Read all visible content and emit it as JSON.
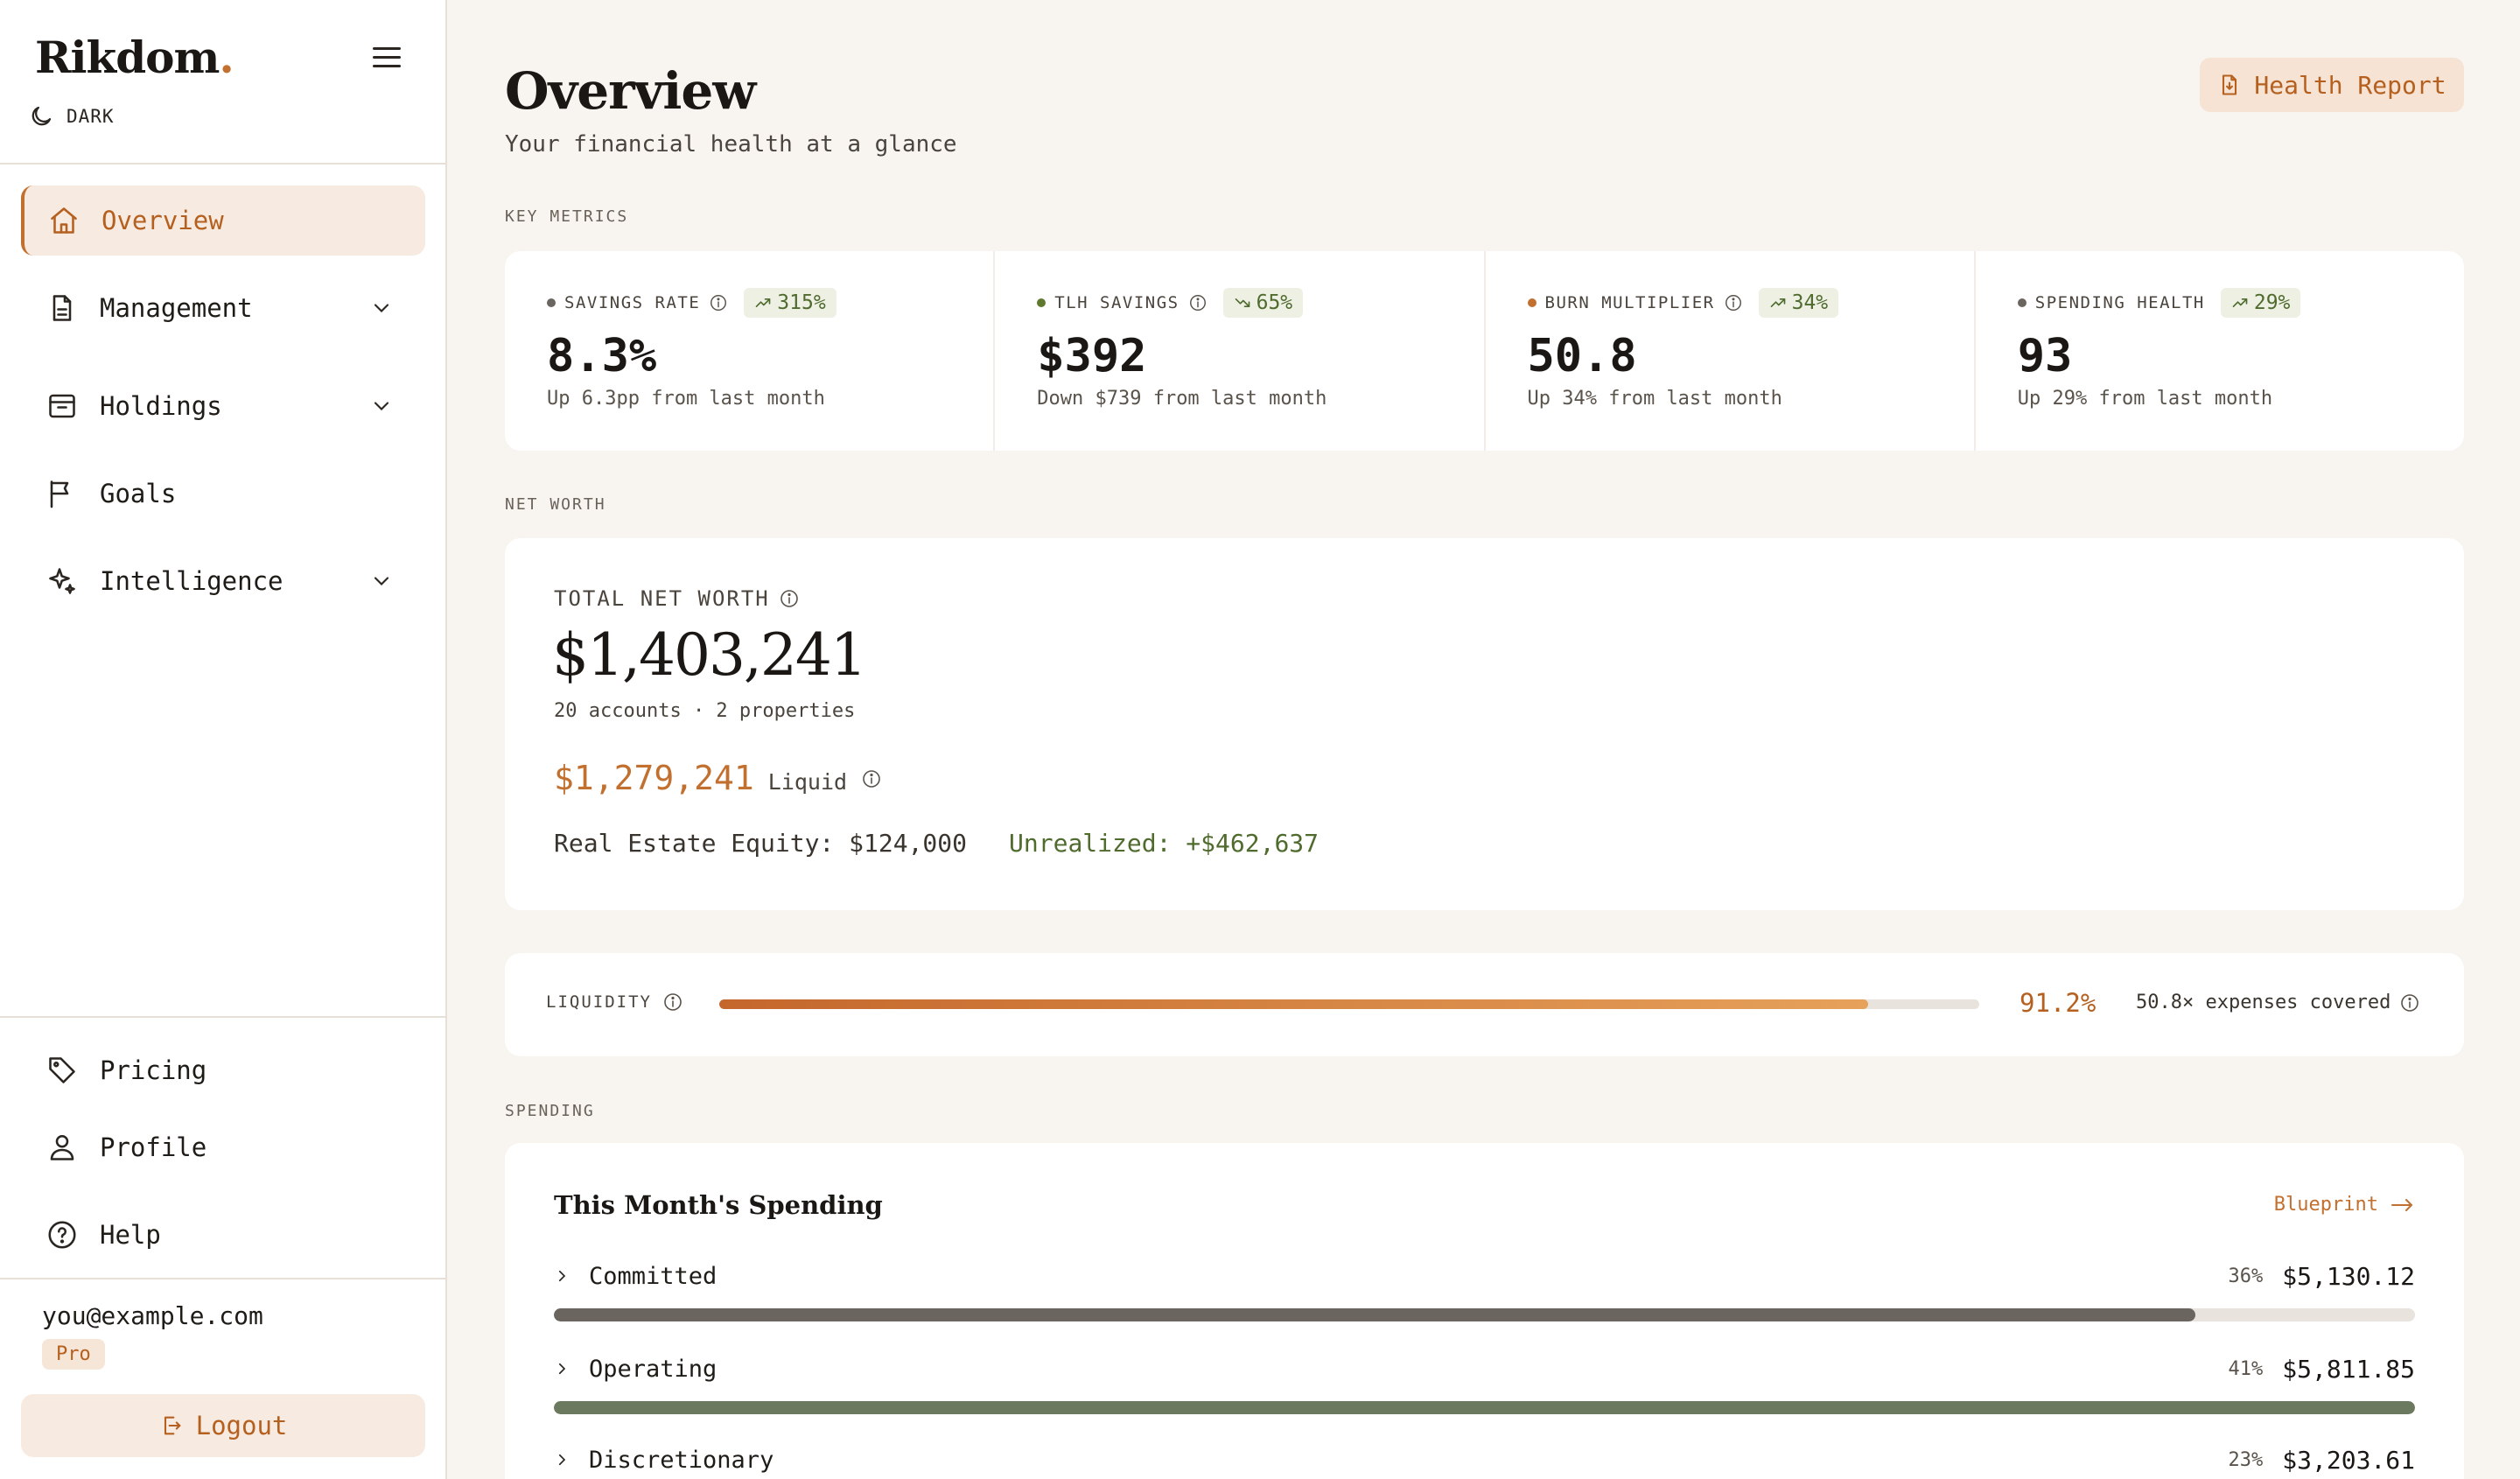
{
  "sidebar": {
    "brand": "Rikdom",
    "brand_dot": ".",
    "theme_label": "DARK",
    "nav": [
      {
        "label": "Overview"
      },
      {
        "label": "Management"
      },
      {
        "label": "Holdings"
      },
      {
        "label": "Goals"
      },
      {
        "label": "Intelligence"
      }
    ],
    "footer_nav": [
      {
        "label": "Pricing"
      },
      {
        "label": "Profile"
      },
      {
        "label": "Help"
      }
    ],
    "user_email": "you@example.com",
    "plan_badge": "Pro",
    "logout_label": "Logout"
  },
  "header": {
    "title": "Overview",
    "subtitle": "Your financial health at a glance",
    "report_button": "Health Report"
  },
  "sections": {
    "key_metrics": "KEY METRICS",
    "net_worth": "NET WORTH",
    "spending": "SPENDING"
  },
  "metrics": [
    {
      "name": "SAVINGS RATE",
      "badge": "315%",
      "trend": "up",
      "value": "8.3%",
      "sub": "Up 6.3pp from last month",
      "dot_color": "#6b6560"
    },
    {
      "name": "TLH SAVINGS",
      "badge": "65%",
      "trend": "down",
      "value": "$392",
      "sub": "Down $739 from last month",
      "dot_color": "#5f7a2e"
    },
    {
      "name": "BURN MULTIPLIER",
      "badge": "34%",
      "trend": "up",
      "value": "50.8",
      "sub": "Up 34% from last month",
      "dot_color": "#c2702f"
    },
    {
      "name": "SPENDING HEALTH",
      "badge": "29%",
      "trend": "up",
      "value": "93",
      "sub": "Up 29% from last month",
      "dot_color": "#6b6560"
    }
  ],
  "net_worth": {
    "label": "TOTAL NET WORTH",
    "value": "$1,403,241",
    "detail": "20 accounts · 2 properties",
    "liquid_amount": "$1,279,241",
    "liquid_label": "Liquid",
    "real_estate": "Real Estate Equity: $124,000",
    "unrealized": "Unrealized: +$462,637"
  },
  "liquidity": {
    "label": "LIQUIDITY",
    "percent_text": "91.2%",
    "fill_fraction": 0.912,
    "coverage": "50.8× expenses covered"
  },
  "spending": {
    "title": "This Month's Spending",
    "link": "Blueprint",
    "rows": [
      {
        "name": "Committed",
        "pct": "36%",
        "amount": "$5,130.12",
        "fill_fraction": 0.882,
        "color": "#6b6560"
      },
      {
        "name": "Operating",
        "pct": "41%",
        "amount": "$5,811.85",
        "fill_fraction": 1.0,
        "color": "#6b7a5e"
      },
      {
        "name": "Discretionary",
        "pct": "23%",
        "amount": "$3,203.61",
        "fill_fraction": 0.55,
        "color": "#c2702f"
      }
    ]
  },
  "colors": {
    "accent": "#c2702f",
    "positive": "#4f6b2e",
    "background": "#f8f5f1"
  }
}
